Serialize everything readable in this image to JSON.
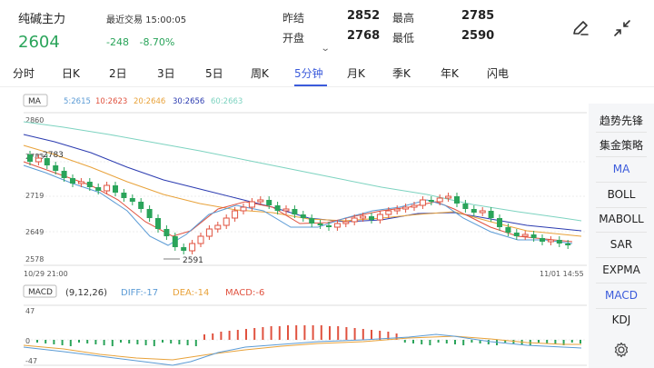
{
  "header": {
    "title": "纯碱主力",
    "price": "2604",
    "trade_label": "最近交易 15:00:05",
    "change": "-248",
    "change_pct": "-8.70%",
    "prev_close_label": "昨结",
    "prev_close": "2852",
    "high_label": "最高",
    "high": "2785",
    "open_label": "开盘",
    "open": "2768",
    "low_label": "最低",
    "low": "2590",
    "price_color": "#2aa45a"
  },
  "tabs": [
    {
      "label": "分时"
    },
    {
      "label": "日K"
    },
    {
      "label": "2日"
    },
    {
      "label": "3日"
    },
    {
      "label": "5日"
    },
    {
      "label": "周K"
    },
    {
      "label": "5分钟"
    },
    {
      "label": "月K"
    },
    {
      "label": "季K"
    },
    {
      "label": "年K"
    },
    {
      "label": "闪电"
    }
  ],
  "active_tab": "5分钟",
  "ma_legend": {
    "label": "MA",
    "items": [
      {
        "text": "5:2615",
        "color": "#5b9bd5"
      },
      {
        "text": "10:2623",
        "color": "#e0523f"
      },
      {
        "text": "20:2646",
        "color": "#e8a23a"
      },
      {
        "text": "30:2656",
        "color": "#2b3bb0"
      },
      {
        "text": "60:2663",
        "color": "#7dd3c0"
      }
    ]
  },
  "price_axis": {
    "ticks": [
      "2860",
      "2783",
      "2719",
      "2649",
      "2578"
    ],
    "max_annotation": "2783",
    "min_annotation": "2591"
  },
  "time_axis": {
    "start": "10/29 21:00",
    "end": "11/01 14:55"
  },
  "macd_legend": {
    "label": "MACD",
    "params": "(9,12,26)",
    "diff": "DIFF:-17",
    "dea": "DEA:-14",
    "macd": "MACD:-6",
    "diff_color": "#5b9bd5",
    "dea_color": "#e8a23a",
    "macd_color": "#e0523f"
  },
  "macd_axis": {
    "ticks": [
      "47",
      "0",
      "-47"
    ]
  },
  "right_panel": {
    "items": [
      {
        "label": "趋势先锋"
      },
      {
        "label": "集金策略"
      },
      {
        "label": "MA"
      },
      {
        "label": "BOLL"
      },
      {
        "label": "MABOLL"
      },
      {
        "label": "SAR"
      },
      {
        "label": "EXPMA"
      },
      {
        "label": "MACD"
      },
      {
        "label": "KDJ"
      }
    ],
    "active": [
      "MA",
      "MACD"
    ]
  },
  "icons": {
    "edit": "pen-icon",
    "collapse": "collapse-arrows-icon",
    "settings": "gear-icon"
  },
  "colors": {
    "up": "#e0523f",
    "down": "#2aa45a",
    "accent": "#3b5bdb"
  }
}
